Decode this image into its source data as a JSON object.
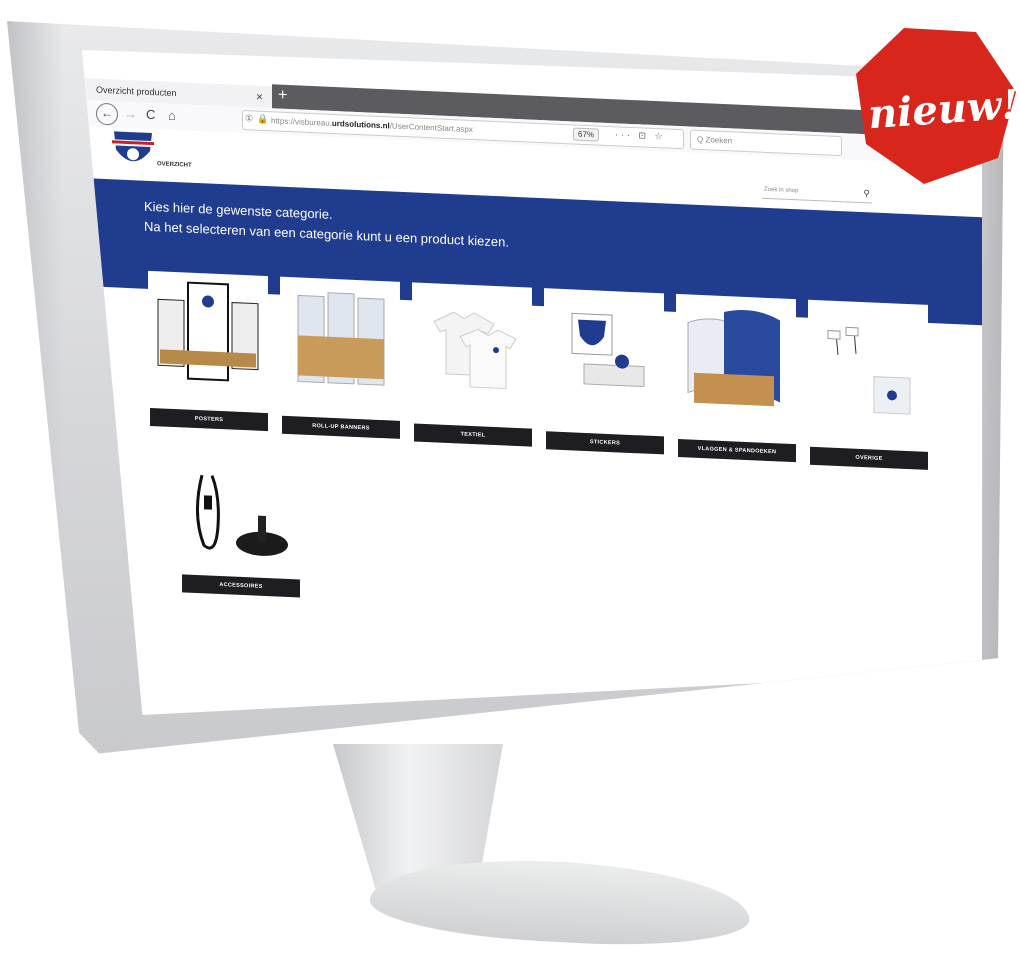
{
  "browser": {
    "tab_title": "Overzicht producten",
    "tab_close": "×",
    "new_tab": "+",
    "nav": {
      "back": "←",
      "forward": "→",
      "reload": "C",
      "home": "⌂"
    },
    "url_shield": "①",
    "url_lock": "🔒",
    "url_prefix": "https://visbureau.",
    "url_host": "urdsolutions.nl",
    "url_path": "/UserContentStart.aspx",
    "zoom": "67%",
    "url_actions": "··· ⊡ ☆",
    "search_placeholder": "Q Zoeken"
  },
  "site": {
    "logo_caption": "OVERZICHT",
    "search_placeholder": "Zoek in shop",
    "search_icon": "⚲",
    "hero": {
      "line1": "Kies hier de gewenste categorie.",
      "line2": "Na het selecteren van een categorie kunt u een product kiezen."
    },
    "categories": [
      {
        "label": "POSTERS"
      },
      {
        "label": "ROLL-UP BANNERS"
      },
      {
        "label": "TEXTIEL"
      },
      {
        "label": "STICKERS"
      },
      {
        "label": "VLAGGEN & SPANDOEKEN"
      },
      {
        "label": "OVERIGE"
      },
      {
        "label": "ACCESSOIRES"
      }
    ]
  },
  "badge": {
    "text": "nieuw!",
    "color": "#d9261c"
  },
  "colors": {
    "hero": "#1f3c8f",
    "button": "#1d1d22"
  }
}
